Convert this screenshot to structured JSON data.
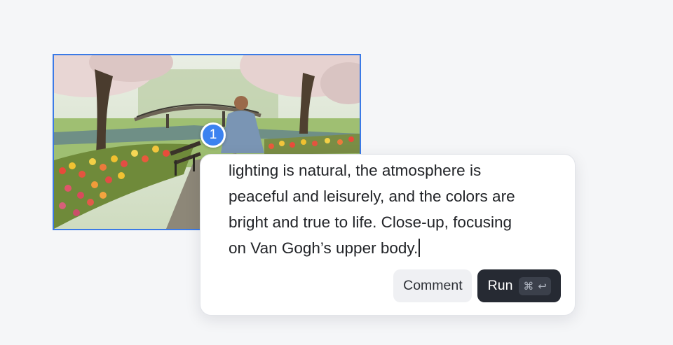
{
  "annotation": {
    "marker_number": "1",
    "image_description_icon": "park-scene-image"
  },
  "prompt": {
    "text": "lighting is natural, the atmosphere is\npeaceful and leisurely, and the colors are\nbright and true to life. Close-up, focusing\non Van Gogh’s upper body."
  },
  "actions": {
    "comment_label": "Comment",
    "run_label": "Run",
    "run_shortcut_cmd": "⌘",
    "run_shortcut_enter": "↩"
  },
  "colors": {
    "selection": "#3b7ae6",
    "marker": "#3c82f0",
    "run_button": "#262a33",
    "comment_button": "#eff0f3"
  }
}
